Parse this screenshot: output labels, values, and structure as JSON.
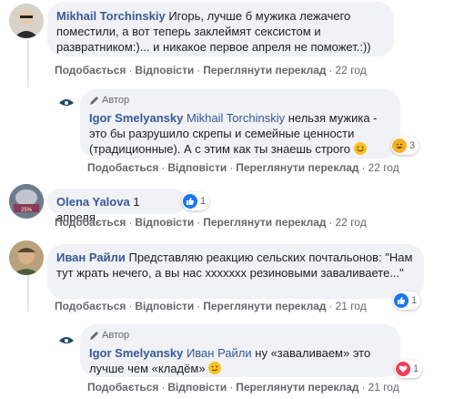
{
  "comments": [
    {
      "author": "Mikhail Torchinskiy",
      "text": "Игорь, лучше б мужика лежачего поместили, а вот теперь заклеймят сексистом и развратником:)... и никакое первое апреля не поможет.:))",
      "actions": [
        "Подобається",
        "Відповісти",
        "Переглянути переклад"
      ],
      "time": "22 год"
    },
    {
      "author_badge": "Автор",
      "author": "Igor Smelyansky",
      "mention": "Mikhail Torchinskiy",
      "text": "нельзя мужика - это бы разрушило скрепы и семейные ценности (традиционные). А с этим как ты знаешь строго",
      "reaction_count": "3",
      "actions": [
        "Подобається",
        "Відповісти",
        "Переглянути переклад"
      ],
      "time": "22 год"
    },
    {
      "author": "Olena Yalova",
      "text": "1 апреля",
      "reaction_count": "1",
      "actions": [
        "Подобається",
        "Відповісти",
        "Переглянути переклад"
      ],
      "time": "22 год"
    },
    {
      "author": "Иван Райли",
      "text": "Представляю реакцию сельских почтальонов: \"Нам тут жрать нечего, а вы нас ххххххх резиновыми заваливаете...\"",
      "reaction_count": "1",
      "actions": [
        "Подобається",
        "Відповісти",
        "Переглянути переклад"
      ],
      "time": "21 год"
    },
    {
      "author_badge": "Автор",
      "author": "Igor Smelyansky",
      "mention": "Иван Райли",
      "text": "ну «заваливаем» это лучше чем «кладём»",
      "reaction_count": "1",
      "actions": [
        "Подобається",
        "Відповісти",
        "Переглянути переклад"
      ],
      "time": "21 год"
    }
  ],
  "colors": {
    "link": "#385898",
    "bubble": "#f0f2f5",
    "like": "#1877f2",
    "love": "#f33e58",
    "haha": "#f7b125"
  }
}
